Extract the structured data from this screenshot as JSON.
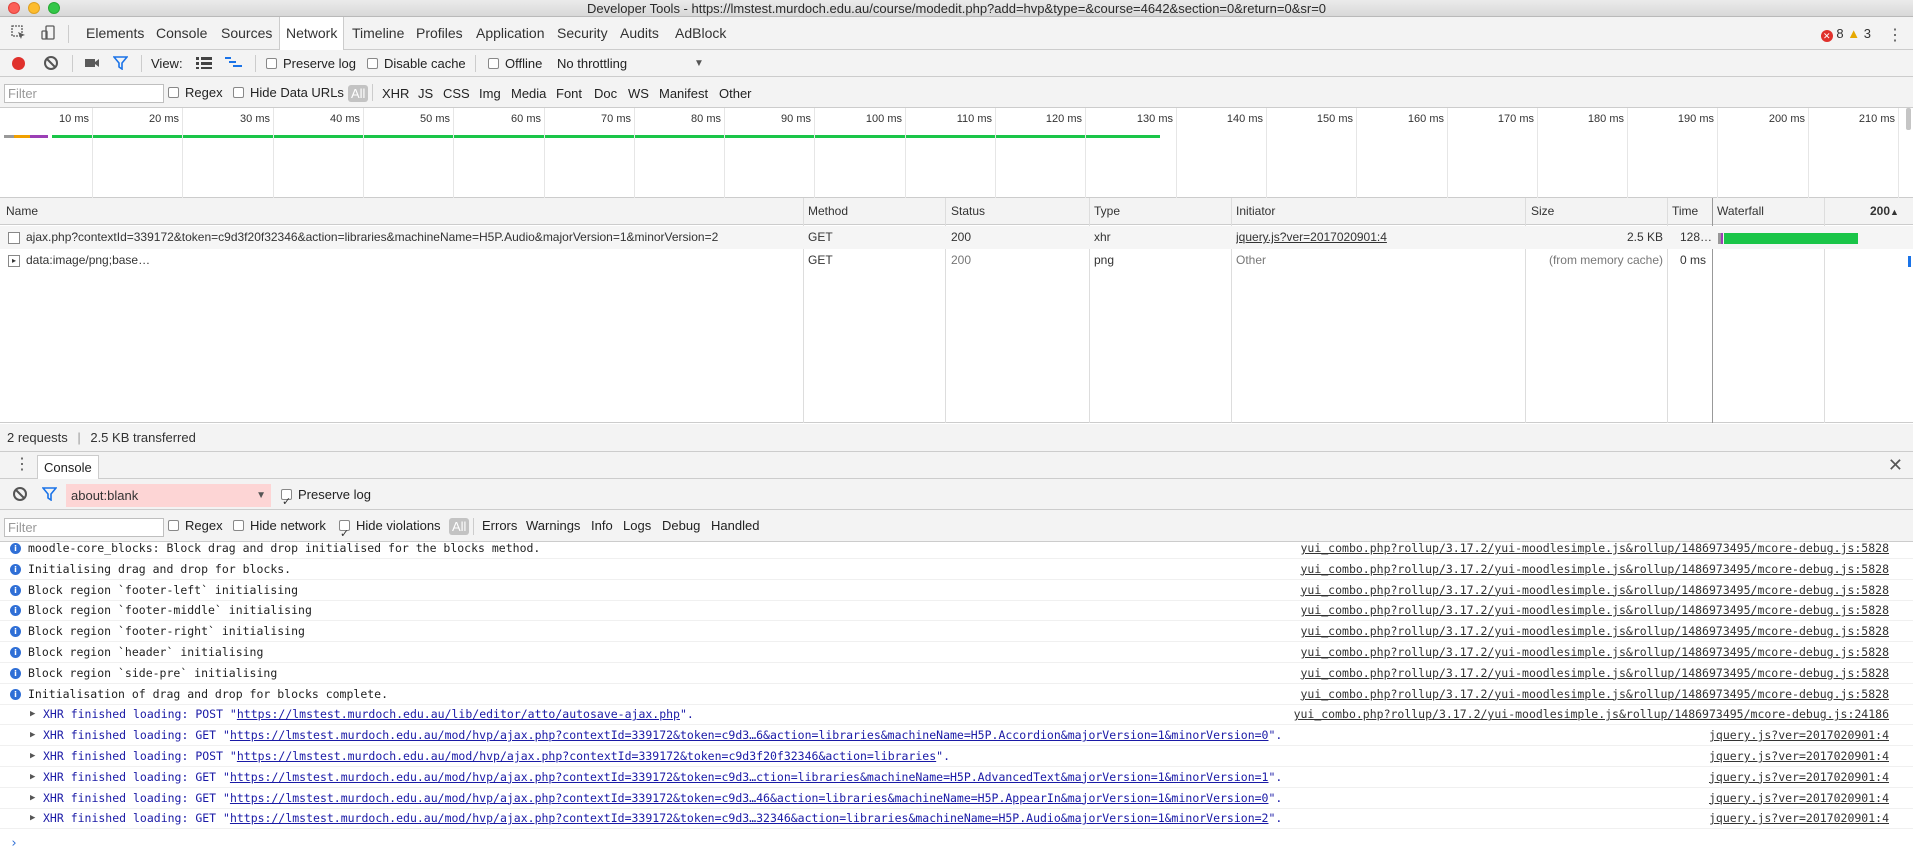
{
  "window": {
    "title": "Developer Tools - https://lmstest.murdoch.edu.au/course/modedit.php?add=hvp&type=&course=4642&section=0&return=0&sr=0"
  },
  "tabs": [
    "Elements",
    "Console",
    "Sources",
    "Network",
    "Timeline",
    "Profiles",
    "Application",
    "Security",
    "Audits",
    "AdBlock"
  ],
  "active_tab": "Network",
  "counts": {
    "errors": "8",
    "warnings": "3"
  },
  "net_toolbar": {
    "view_label": "View:",
    "preserve_log": "Preserve log",
    "disable_cache": "Disable cache",
    "offline": "Offline",
    "throttling": "No throttling"
  },
  "filter_bar": {
    "placeholder": "Filter",
    "regex": "Regex",
    "hide_data_urls": "Hide Data URLs",
    "types": [
      "All",
      "XHR",
      "JS",
      "CSS",
      "Img",
      "Media",
      "Font",
      "Doc",
      "WS",
      "Manifest",
      "Other"
    ]
  },
  "overview_ticks": [
    "10 ms",
    "20 ms",
    "30 ms",
    "40 ms",
    "50 ms",
    "60 ms",
    "70 ms",
    "80 ms",
    "90 ms",
    "100 ms",
    "110 ms",
    "120 ms",
    "130 ms",
    "140 ms",
    "150 ms",
    "160 ms",
    "170 ms",
    "180 ms",
    "190 ms",
    "200 ms",
    "210 ms"
  ],
  "table": {
    "headers": {
      "name": "Name",
      "method": "Method",
      "status": "Status",
      "type": "Type",
      "initiator": "Initiator",
      "size": "Size",
      "time": "Time",
      "waterfall": "Waterfall",
      "waterfall_scale": "200"
    },
    "rows": [
      {
        "name": "ajax.php?contextId=339172&token=c9d3f20f32346&action=libraries&machineName=H5P.Audio&majorVersion=1&minorVersion=2",
        "method": "GET",
        "status": "200",
        "type": "xhr",
        "initiator": "jquery.js?ver=2017020901:4",
        "size": "2.5 KB",
        "time": "128…"
      },
      {
        "name": "data:image/png;base…",
        "method": "GET",
        "status": "200",
        "type": "png",
        "initiator": "Other",
        "size": "(from memory cache)",
        "time": "0 ms"
      }
    ]
  },
  "summary": {
    "requests": "2 requests",
    "transferred": "2.5 KB transferred"
  },
  "drawer": {
    "tab": "Console"
  },
  "console_toolbar": {
    "context": "about:blank",
    "preserve_log": "Preserve log",
    "filter_placeholder": "Filter",
    "regex": "Regex",
    "hide_network": "Hide network",
    "hide_violations": "Hide violations",
    "levels": [
      "All",
      "Errors",
      "Warnings",
      "Info",
      "Logs",
      "Debug",
      "Handled"
    ]
  },
  "console_messages": [
    {
      "kind": "info",
      "text": "moodle-core_blocks: Block drag and drop initialised for the blocks method.",
      "source": "yui_combo.php?rollup/3.17.2/yui-moodlesimple.js&rollup/1486973495/mcore-debug.js:5828"
    },
    {
      "kind": "info",
      "text": "Initialising drag and drop for blocks.",
      "source": "yui_combo.php?rollup/3.17.2/yui-moodlesimple.js&rollup/1486973495/mcore-debug.js:5828"
    },
    {
      "kind": "info",
      "text": "Block region `footer-left` initialising",
      "source": "yui_combo.php?rollup/3.17.2/yui-moodlesimple.js&rollup/1486973495/mcore-debug.js:5828"
    },
    {
      "kind": "info",
      "text": "Block region `footer-middle` initialising",
      "source": "yui_combo.php?rollup/3.17.2/yui-moodlesimple.js&rollup/1486973495/mcore-debug.js:5828"
    },
    {
      "kind": "info",
      "text": "Block region `footer-right` initialising",
      "source": "yui_combo.php?rollup/3.17.2/yui-moodlesimple.js&rollup/1486973495/mcore-debug.js:5828"
    },
    {
      "kind": "info",
      "text": "Block region `header` initialising",
      "source": "yui_combo.php?rollup/3.17.2/yui-moodlesimple.js&rollup/1486973495/mcore-debug.js:5828"
    },
    {
      "kind": "info",
      "text": "Block region `side-pre` initialising",
      "source": "yui_combo.php?rollup/3.17.2/yui-moodlesimple.js&rollup/1486973495/mcore-debug.js:5828"
    },
    {
      "kind": "info",
      "text": "Initialisation of drag and drop for blocks complete.",
      "source": "yui_combo.php?rollup/3.17.2/yui-moodlesimple.js&rollup/1486973495/mcore-debug.js:5828"
    },
    {
      "kind": "xhr",
      "prefix": "XHR finished loading: POST \"",
      "url": "https://lmstest.murdoch.edu.au/lib/editor/atto/autosave-ajax.php",
      "suffix": "\".",
      "source": "yui_combo.php?rollup/3.17.2/yui-moodlesimple.js&rollup/1486973495/mcore-debug.js:24186"
    },
    {
      "kind": "xhr",
      "prefix": "XHR finished loading: GET \"",
      "url": "https://lmstest.murdoch.edu.au/mod/hvp/ajax.php?contextId=339172&token=c9d3…6&action=libraries&machineName=H5P.Accordion&majorVersion=1&minorVersion=0",
      "suffix": "\".",
      "source": "jquery.js?ver=2017020901:4"
    },
    {
      "kind": "xhr",
      "prefix": "XHR finished loading: POST \"",
      "url": "https://lmstest.murdoch.edu.au/mod/hvp/ajax.php?contextId=339172&token=c9d3f20f32346&action=libraries",
      "suffix": "\".",
      "source": "jquery.js?ver=2017020901:4"
    },
    {
      "kind": "xhr",
      "prefix": "XHR finished loading: GET \"",
      "url": "https://lmstest.murdoch.edu.au/mod/hvp/ajax.php?contextId=339172&token=c9d3…ction=libraries&machineName=H5P.AdvancedText&majorVersion=1&minorVersion=1",
      "suffix": "\".",
      "source": "jquery.js?ver=2017020901:4"
    },
    {
      "kind": "xhr",
      "prefix": "XHR finished loading: GET \"",
      "url": "https://lmstest.murdoch.edu.au/mod/hvp/ajax.php?contextId=339172&token=c9d3…46&action=libraries&machineName=H5P.AppearIn&majorVersion=1&minorVersion=0",
      "suffix": "\".",
      "source": "jquery.js?ver=2017020901:4"
    },
    {
      "kind": "xhr",
      "prefix": "XHR finished loading: GET \"",
      "url": "https://lmstest.murdoch.edu.au/mod/hvp/ajax.php?contextId=339172&token=c9d3…32346&action=libraries&machineName=H5P.Audio&majorVersion=1&minorVersion=2",
      "suffix": "\".",
      "source": "jquery.js?ver=2017020901:4"
    }
  ],
  "colors": {
    "record": "#e0312c",
    "waterfall_bar": "#1ac548",
    "info": "#2f6fd6",
    "xhr_text": "#1a1aa6",
    "context_bg": "#fdd5d5"
  }
}
